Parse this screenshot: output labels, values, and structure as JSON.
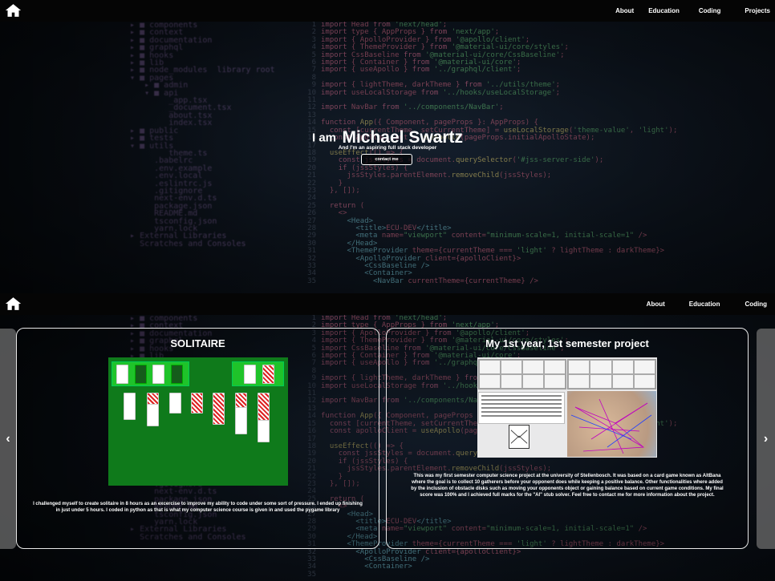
{
  "nav_top": {
    "links": [
      "About",
      "Education",
      "Coding",
      "Projects"
    ]
  },
  "nav_mid": {
    "links": [
      "About",
      "Education",
      "Coding"
    ]
  },
  "hero": {
    "prefix": "I am",
    "name": "Michael Swartz",
    "subtitle": "And I'm an aspiring full stack developer",
    "button_label": "contact me"
  },
  "projects": {
    "prev_arrow": "‹",
    "next_arrow": "›",
    "cards": [
      {
        "title": "SOLITAIRE",
        "description": "I challenged myself to create solitaire in 8 hours as an excercise to improve my ability to code under some sort of pressure. I ended up finishing in just under 5 hours. I coded in python as that is what my computer science course is given in and used the pygame library"
      },
      {
        "title": "My 1st year, 1st semester project",
        "description": "This was my first semester computer science project at the university of Stellenbosch. It was based on a card game known as AltBana where the goal is to collect 10 gatherers before your opponent does while keeping a positive balance. Other functionalities where added by the inclusion of obstacle disks such as moving your opponents object or gaining balance based on current game conditions. My final score was 100% and I achieved full marks for the \"AI\" stub solver. Feel free to contact me for more information about the project."
      }
    ]
  },
  "icons": {
    "home": "home-icon"
  }
}
